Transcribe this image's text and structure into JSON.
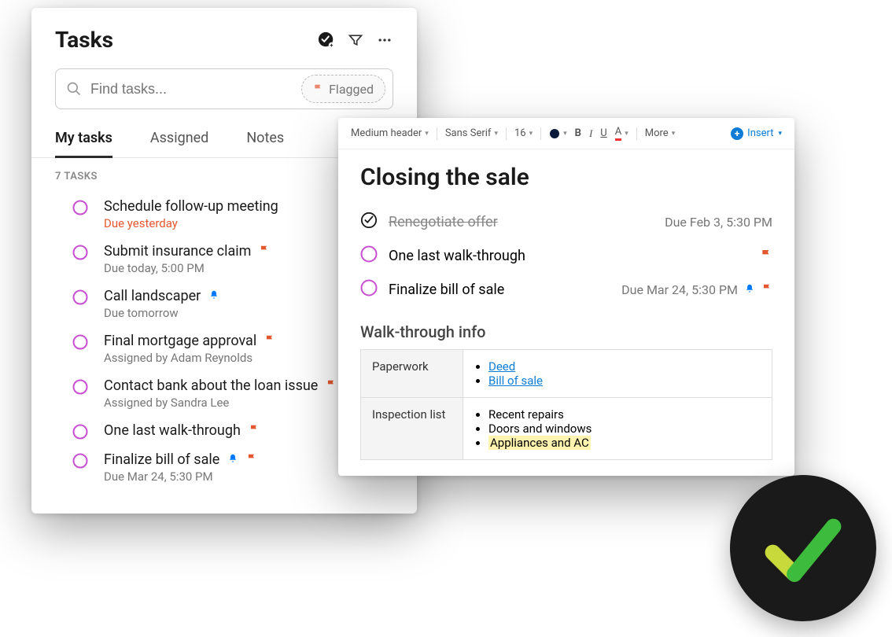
{
  "tasks_panel": {
    "title": "Tasks",
    "search_placeholder": "Find tasks...",
    "flagged_label": "Flagged",
    "tabs": {
      "my_tasks": "My tasks",
      "assigned": "Assigned",
      "notes": "Notes"
    },
    "count_label": "7 TASKS",
    "tasks": [
      {
        "title": "Schedule follow-up meeting",
        "sub": "Due yesterday"
      },
      {
        "title": "Submit insurance claim",
        "sub": "Due today, 5:00 PM"
      },
      {
        "title": "Call landscaper",
        "sub": "Due tomorrow"
      },
      {
        "title": "Final mortgage approval",
        "sub": "Assigned by Adam Reynolds"
      },
      {
        "title": "Contact bank about the loan issue",
        "sub": "Assigned by Sandra Lee"
      },
      {
        "title": "One last walk-through",
        "sub": ""
      },
      {
        "title": "Finalize bill of sale",
        "sub": "Due Mar 24, 5:30 PM"
      }
    ]
  },
  "editor": {
    "title": "Closing the sale",
    "toolbar": {
      "header_style": "Medium header",
      "font_family": "Sans Serif",
      "font_size": "16",
      "bold": "B",
      "italic": "I",
      "underline": "U",
      "color_label": "A",
      "more": "More",
      "insert": "Insert"
    },
    "tasks": [
      {
        "title": "Renegotiate offer",
        "due": "Due Feb 3, 5:30 PM"
      },
      {
        "title": "One last walk-through",
        "due": ""
      },
      {
        "title": "Finalize bill of sale",
        "due": "Due Mar 24, 5:30 PM"
      }
    ],
    "section_title": "Walk-through info",
    "table": {
      "row1_label": "Paperwork",
      "row1_items": {
        "deed": "Deed",
        "bill": "Bill of sale"
      },
      "row2_label": "Inspection list",
      "row2_items": {
        "repairs": "Recent repairs",
        "doors": "Doors and windows",
        "appliances": "Appliances and AC"
      }
    }
  }
}
